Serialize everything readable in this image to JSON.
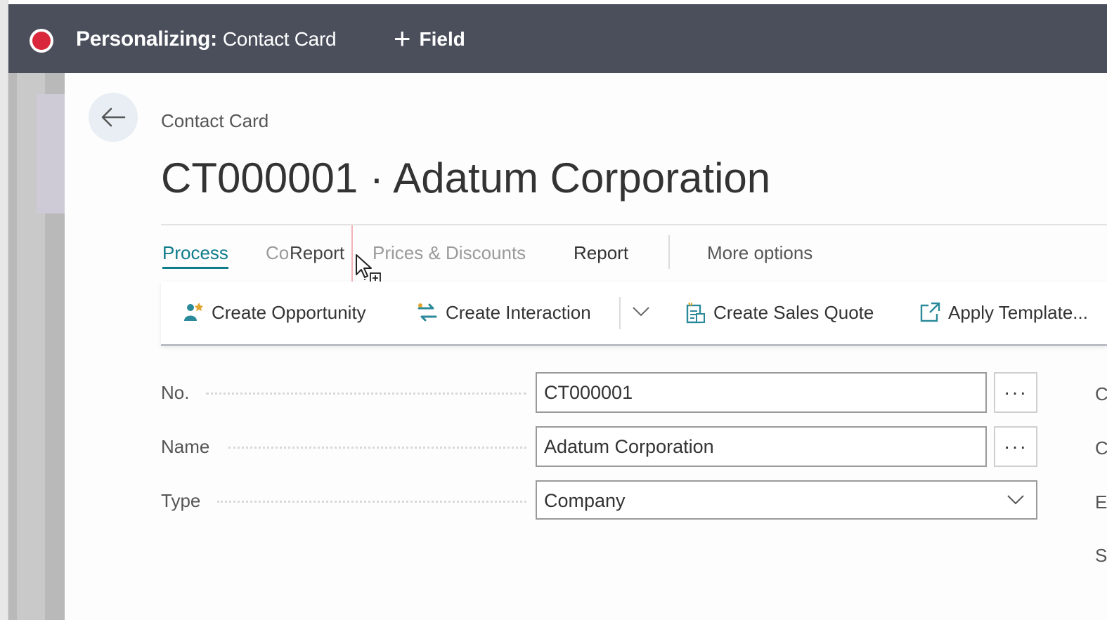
{
  "topbar": {
    "title_bold": "Personalizing:",
    "title_sub": "Contact Card",
    "field_label": "Field",
    "colors": {
      "background": "#4b4f5c",
      "record": "#d9283c"
    }
  },
  "header": {
    "breadcrumb": "Contact Card",
    "title": "CT000001 · Adatum Corporation"
  },
  "tabs": [
    {
      "label": "Process"
    },
    {
      "label": "Co"
    },
    {
      "label": "Report"
    },
    {
      "label": "Prices & Discounts"
    },
    {
      "label": "Report"
    },
    {
      "label": "More options"
    }
  ],
  "actions": [
    {
      "label": "Create Opportunity",
      "icon": "opportunity-icon"
    },
    {
      "label": "Create Interaction",
      "icon": "interaction-icon"
    },
    {
      "label": "Create Sales Quote",
      "icon": "sales-quote-icon"
    },
    {
      "label": "Apply Template...",
      "icon": "apply-template-icon"
    }
  ],
  "form": {
    "no": {
      "label": "No.",
      "value": "CT000001"
    },
    "name": {
      "label": "Name",
      "value": "Adatum Corporation"
    },
    "type": {
      "label": "Type",
      "value": "Company"
    },
    "ellipsis": "···"
  },
  "right_column": [
    "C",
    "C",
    "E",
    "S"
  ],
  "accent": "#0f7c8a"
}
